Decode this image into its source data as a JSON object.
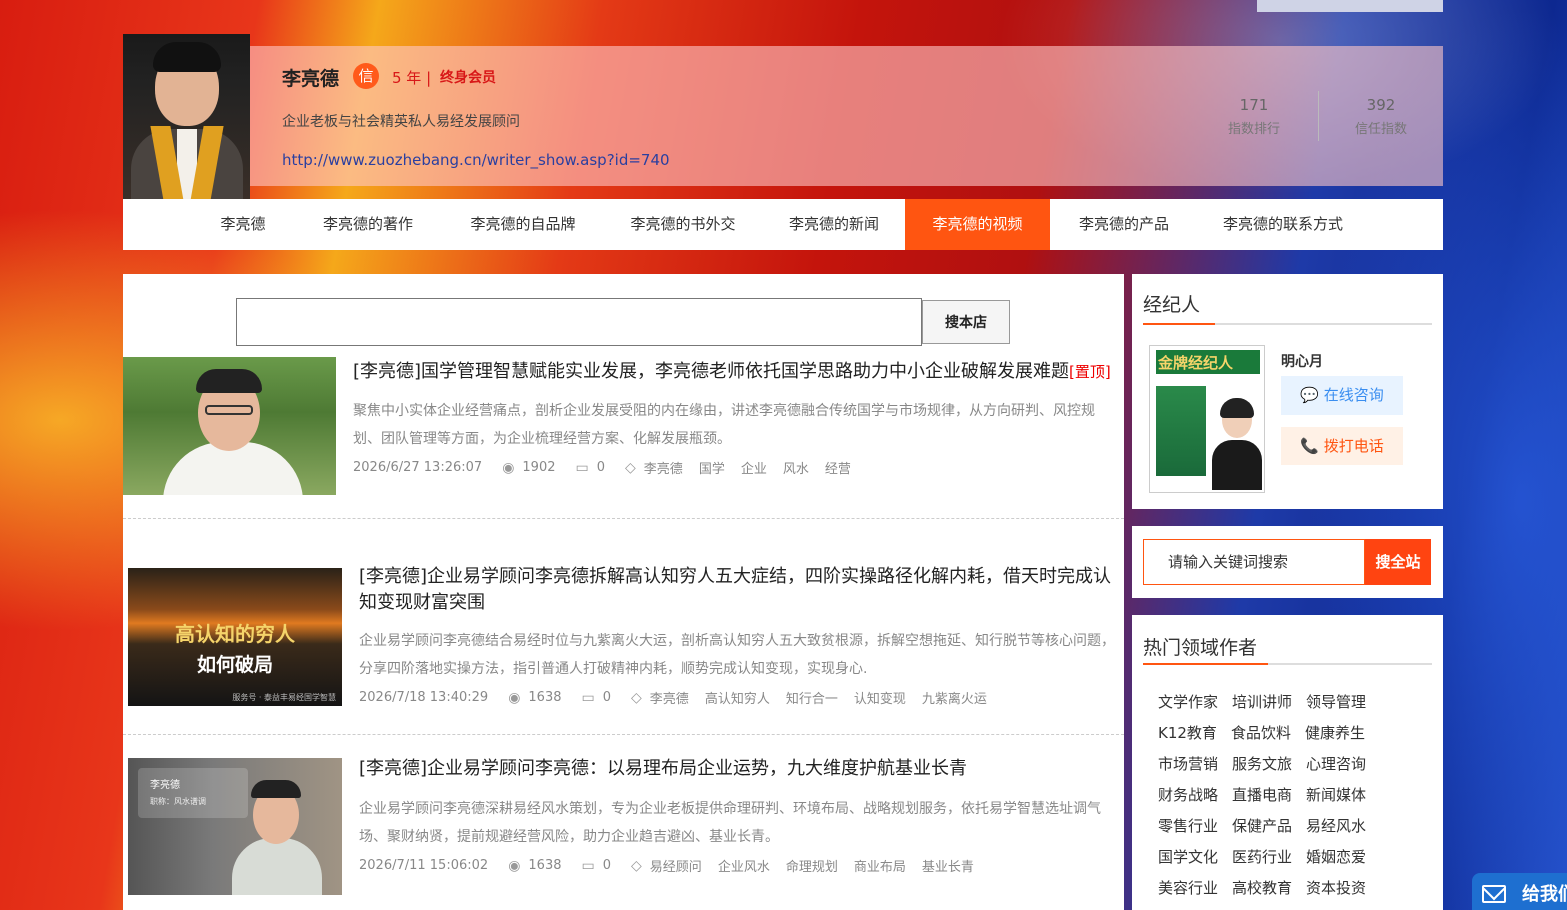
{
  "profile": {
    "name": "李亮德",
    "badge": "信",
    "years": "5 年 |",
    "member": "终身会员",
    "tagline": "企业老板与社会精英私人易经发展顾问",
    "url": "http://www.zuozhebang.cn/writer_show.asp?id=740",
    "stats": [
      {
        "value": "171",
        "label": "指数排行"
      },
      {
        "value": "392",
        "label": "信任指数"
      }
    ]
  },
  "nav": {
    "items": [
      {
        "label": "李亮德"
      },
      {
        "label": "李亮德的著作"
      },
      {
        "label": "李亮德的自品牌"
      },
      {
        "label": "李亮德的书外交"
      },
      {
        "label": "李亮德的新闻"
      },
      {
        "label": "李亮德的视频",
        "active": true
      },
      {
        "label": "李亮德的产品"
      },
      {
        "label": "李亮德的联系方式"
      }
    ]
  },
  "search": {
    "value": "",
    "button": "搜本店"
  },
  "articles": [
    {
      "title": "[李亮德]国学管理智慧赋能实业发展，李亮德老师依托国学思路助力中小企业破解发展难题",
      "pinned": "[置顶]",
      "desc": "聚焦中小实体企业经营痛点，剖析企业发展受阻的内在缘由，讲述李亮德融合传统国学与市场规律，从方向研判、风控规划、团队管理等方面，为企业梳理经营方案、化解发展瓶颈。",
      "date": "2026/6/27 13:26:07",
      "views": "1902",
      "comments": "0",
      "tags": [
        "李亮德",
        "国学",
        "企业",
        "风水",
        "经营"
      ]
    },
    {
      "title": "[李亮德]企业易学顾问李亮德拆解高认知穷人五大症结，四阶实操路径化解内耗，借天时完成认知变现财富突围",
      "pinned": "",
      "desc": "企业易学顾问李亮德结合易经时位与九紫离火大运，剖析高认知穷人五大致贫根源，拆解空想拖延、知行脱节等核心问题，分享四阶落地实操方法，指引普通人打破精神内耗，顺势完成认知变现，实现身心.",
      "date": "2026/7/18 13:40:29",
      "views": "1638",
      "comments": "0",
      "tags": [
        "李亮德",
        "高认知穷人",
        "知行合一",
        "认知变现",
        "九紫离火运"
      ],
      "thumb_text": [
        "高认知的穷人",
        "如何破局"
      ],
      "thumb_caption": "服务号 · 泰益丰易经国学智慧"
    },
    {
      "title": "[李亮德]企业易学顾问李亮德：以易理布局企业运势，九大维度护航基业长青",
      "pinned": "",
      "desc": "企业易学顾问李亮德深耕易经风水策划，专为企业老板提供命理研判、环境布局、战略规划服务，依托易学智慧选址调气场、聚财纳贤，提前规避经营风险，助力企业趋吉避凶、基业长青。",
      "date": "2026/7/11 15:06:02",
      "views": "1638",
      "comments": "0",
      "tags": [
        "易经顾问",
        "企业风水",
        "命理规划",
        "商业布局",
        "基业长青"
      ],
      "thumb_name": "李亮德",
      "thumb_role": "职称：风水谱调"
    }
  ],
  "sidebar": {
    "agent": {
      "title": "经纪人",
      "poster_title": "金牌经纪人",
      "name": "明心月",
      "consult": "在线咨询",
      "call": "拨打电话"
    },
    "site_search": {
      "placeholder": "请输入关键词搜索",
      "button": "搜全站"
    },
    "hot": {
      "title": "热门领域作者",
      "categories": [
        "文学作家",
        "培训讲师",
        "领导管理",
        "K12教育",
        "食品饮料",
        "健康养生",
        "市场营销",
        "服务文旅",
        "心理咨询",
        "财务战略",
        "直播电商",
        "新闻媒体",
        "零售行业",
        "保健产品",
        "易经风水",
        "国学文化",
        "医药行业",
        "婚姻恋爱",
        "美容行业",
        "高校教育",
        "资本投资"
      ]
    }
  },
  "feedback": {
    "label": "给我们"
  },
  "colors": {
    "accent": "#ff5511",
    "link": "#2a3fa0",
    "pinned": "#e00000"
  }
}
